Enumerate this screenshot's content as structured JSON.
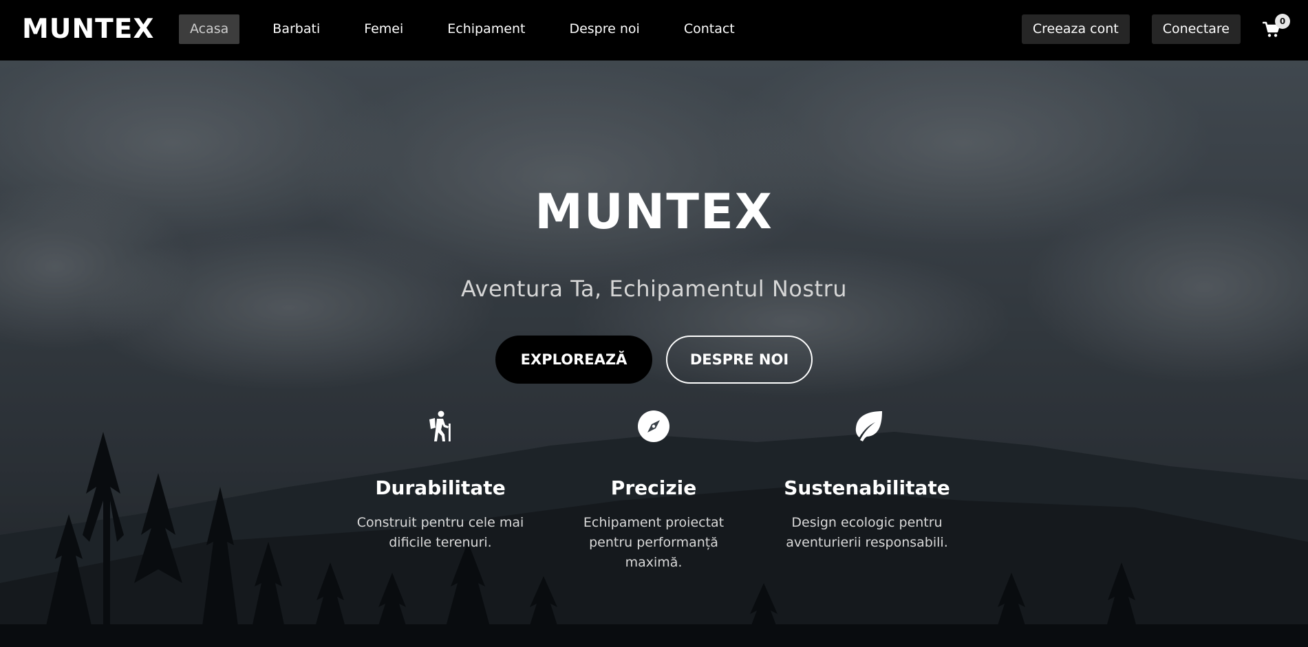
{
  "nav": {
    "logo": "MUNTEX",
    "links": [
      "Acasa",
      "Barbati",
      "Femei",
      "Echipament",
      "Despre noi",
      "Contact"
    ],
    "active_index": 0,
    "create_account": "Creeaza cont",
    "login": "Conectare",
    "cart_count": "0",
    "cart_icon": "shopping-cart-icon"
  },
  "hero": {
    "title": "MUNTEX",
    "subtitle": "Aventura Ta, Echipamentul Nostru",
    "primary_button": "EXPLOREAZĂ",
    "secondary_button": "DESPRE NOI"
  },
  "features": [
    {
      "icon": "hiking-icon",
      "title": "Durabilitate",
      "description": "Construit pentru cele mai dificile terenuri."
    },
    {
      "icon": "compass-icon",
      "title": "Precizie",
      "description": "Echipament proiectat pentru performanță maximă."
    },
    {
      "icon": "leaf-icon",
      "title": "Sustenabilitate",
      "description": "Design ecologic pentru aventurierii responsabili."
    }
  ],
  "colors": {
    "navbar_bg": "#000000",
    "active_link_bg": "#3d3d3d",
    "nav_button_bg": "#262626",
    "primary_button_bg": "#000000",
    "text": "#ffffff"
  }
}
